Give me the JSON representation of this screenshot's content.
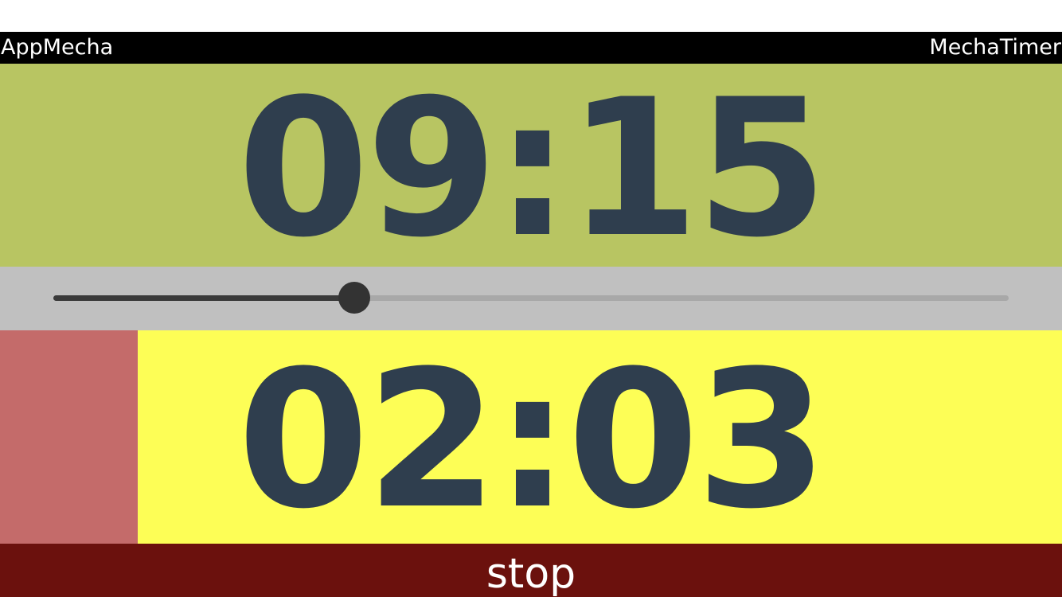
{
  "header": {
    "left_label": "AppMecha",
    "right_label": "MechaTimer"
  },
  "main_timer": {
    "time": "09:15",
    "background": "#b8c562",
    "text_color": "#2f3e4e"
  },
  "slider": {
    "value_fraction": 0.315,
    "track_color": "#a8a8a8",
    "fill_color": "#3a3a3a",
    "thumb_color": "#333333"
  },
  "sub_timer": {
    "time": "02:03",
    "background": "#fdfe56",
    "progress_fraction": 0.13,
    "progress_color": "#c46b6a"
  },
  "stop_button": {
    "label": "stop",
    "background": "#6b110d"
  }
}
